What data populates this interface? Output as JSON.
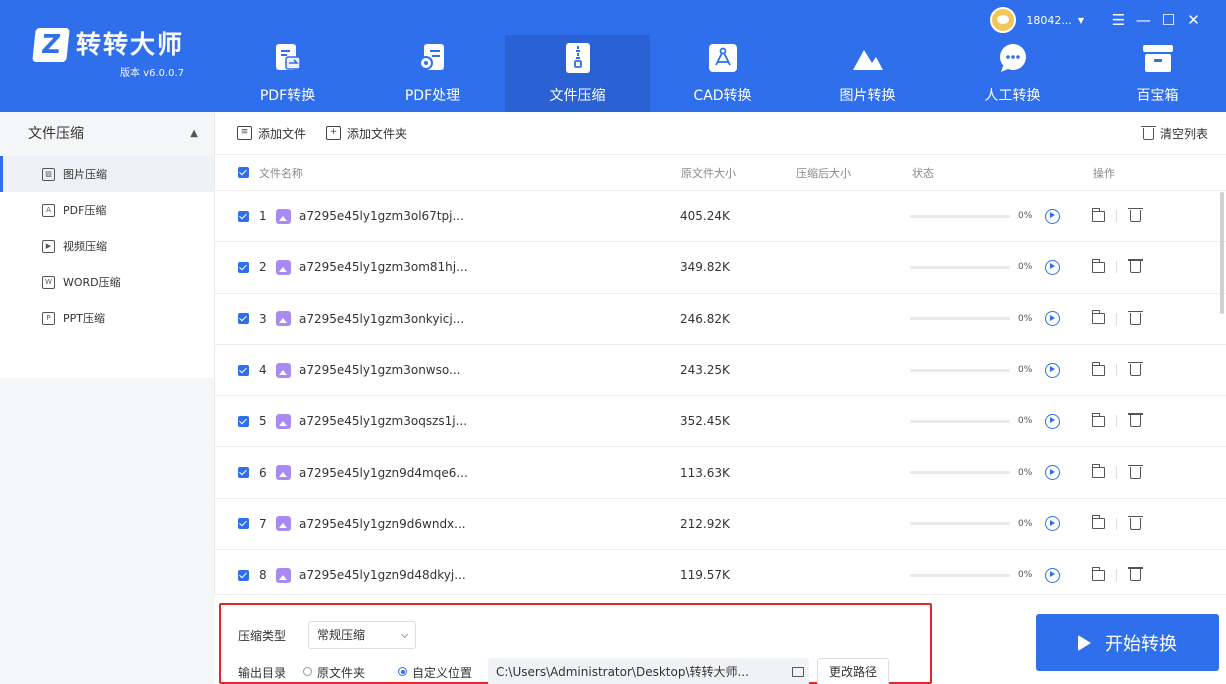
{
  "app": {
    "name": "转转大师",
    "version": "版本 v6.0.0.7",
    "user": "18042...",
    "accent": "#2f6fec",
    "highlight": "#e0282e"
  },
  "nav": [
    {
      "label": "PDF转换",
      "icon": "pdf-convert-icon"
    },
    {
      "label": "PDF处理",
      "icon": "pdf-process-icon"
    },
    {
      "label": "文件压缩",
      "icon": "zip-icon",
      "active": true
    },
    {
      "label": "CAD转换",
      "icon": "cad-icon"
    },
    {
      "label": "图片转换",
      "icon": "image-icon"
    },
    {
      "label": "人工转换",
      "icon": "chat-icon"
    },
    {
      "label": "百宝箱",
      "icon": "toolbox-icon"
    }
  ],
  "sidebar": {
    "title": "文件压缩",
    "items": [
      {
        "label": "图片压缩",
        "icon": "image-icon",
        "active": true
      },
      {
        "label": "PDF压缩",
        "icon": "pdf-icon"
      },
      {
        "label": "视频压缩",
        "icon": "video-icon"
      },
      {
        "label": "WORD压缩",
        "icon": "word-icon"
      },
      {
        "label": "PPT压缩",
        "icon": "ppt-icon"
      }
    ]
  },
  "toolbar": {
    "add_file": "添加文件",
    "add_folder": "添加文件夹",
    "clear_list": "清空列表"
  },
  "table": {
    "columns": [
      "文件名称",
      "原文件大小",
      "压缩后大小",
      "状态",
      "操作"
    ],
    "rows": [
      {
        "num": "1",
        "name": "a7295e45ly1gzm3ol67tpj...",
        "size": "405.24K",
        "compressed": "",
        "progress": "0%",
        "progress_value": 0
      },
      {
        "num": "2",
        "name": "a7295e45ly1gzm3om81hj...",
        "size": "349.82K",
        "compressed": "",
        "progress": "0%",
        "progress_value": 0
      },
      {
        "num": "3",
        "name": "a7295e45ly1gzm3onkyicj...",
        "size": "246.82K",
        "compressed": "",
        "progress": "0%",
        "progress_value": 0
      },
      {
        "num": "4",
        "name": "a7295e45ly1gzm3onwso...",
        "size": "243.25K",
        "compressed": "",
        "progress": "0%",
        "progress_value": 0
      },
      {
        "num": "5",
        "name": "a7295e45ly1gzm3oqszs1j...",
        "size": "352.45K",
        "compressed": "",
        "progress": "0%",
        "progress_value": 0
      },
      {
        "num": "6",
        "name": "a7295e45ly1gzn9d4mqe6...",
        "size": "113.63K",
        "compressed": "",
        "progress": "0%",
        "progress_value": 0
      },
      {
        "num": "7",
        "name": "a7295e45ly1gzn9d6wndx...",
        "size": "212.92K",
        "compressed": "",
        "progress": "0%",
        "progress_value": 0
      },
      {
        "num": "8",
        "name": "a7295e45ly1gzn9d48dkyj...",
        "size": "119.57K",
        "compressed": "",
        "progress": "0%",
        "progress_value": 0
      }
    ]
  },
  "options": {
    "compress_type_label": "压缩类型",
    "compress_type_value": "常规压缩",
    "output_label": "输出目录",
    "radio_original": "原文件夹",
    "radio_custom": "自定义位置",
    "selected_output": "custom",
    "path": "C:\\Users\\Administrator\\Desktop\\转转大师...",
    "change_path": "更改路径"
  },
  "start_button": "开始转换"
}
